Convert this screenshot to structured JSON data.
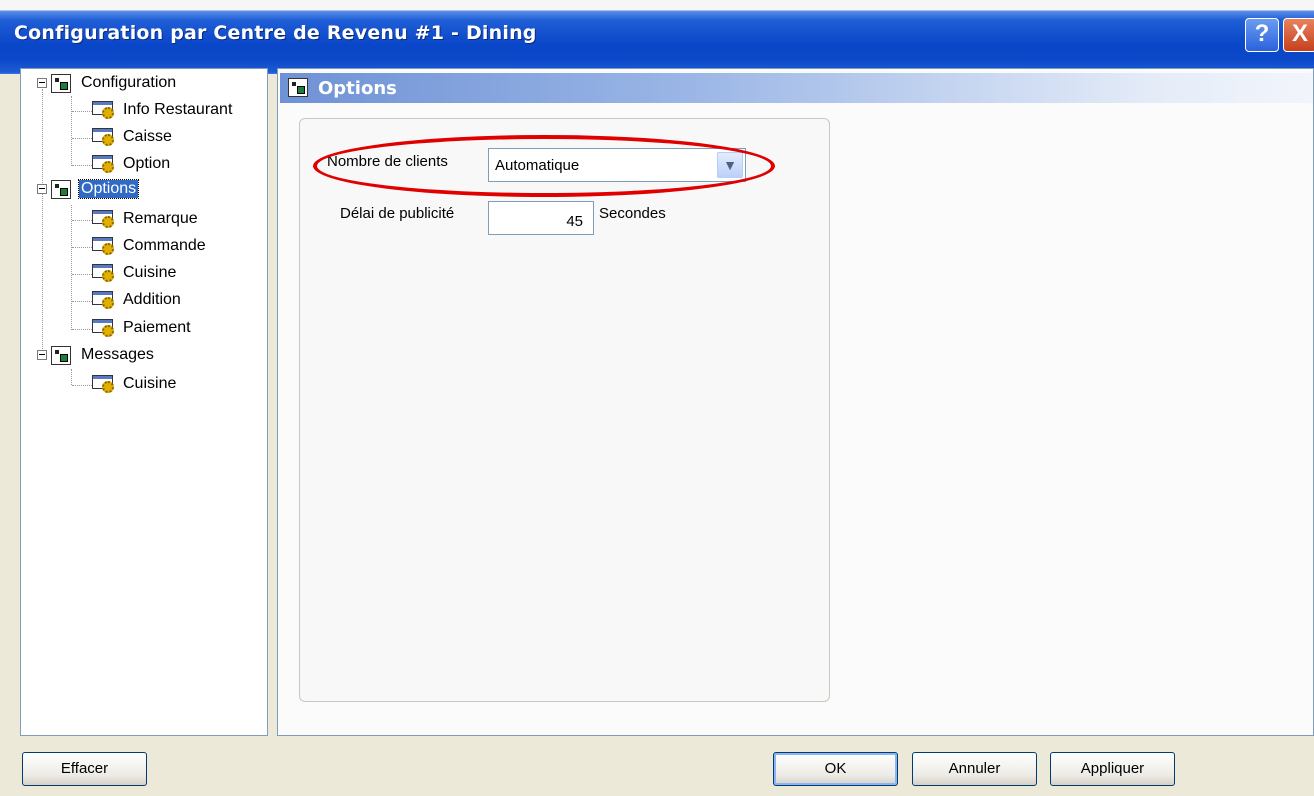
{
  "window": {
    "title": "Configuration par Centre de Revenu #1 - Dining",
    "help_label": "?",
    "close_label": "X"
  },
  "tree": {
    "groups": [
      {
        "label": "Configuration",
        "children": [
          "Info Restaurant",
          "Caisse",
          "Option"
        ]
      },
      {
        "label": "Options",
        "selected": true,
        "children": [
          "Remarque",
          "Commande",
          "Cuisine",
          "Addition",
          "Paiement"
        ]
      },
      {
        "label": "Messages",
        "children": [
          "Cuisine"
        ]
      }
    ]
  },
  "pane": {
    "title": "Options",
    "clients_label": "Nombre de clients",
    "clients_value": "Automatique",
    "delay_label": "Délai de publicité",
    "delay_value": "45",
    "delay_unit": "Secondes"
  },
  "buttons": {
    "clear": "Effacer",
    "ok": "OK",
    "cancel": "Annuler",
    "apply": "Appliquer"
  },
  "colors": {
    "titlebar": "#0a46c8",
    "selection": "#316ac5",
    "highlight_ring": "#e00000"
  }
}
